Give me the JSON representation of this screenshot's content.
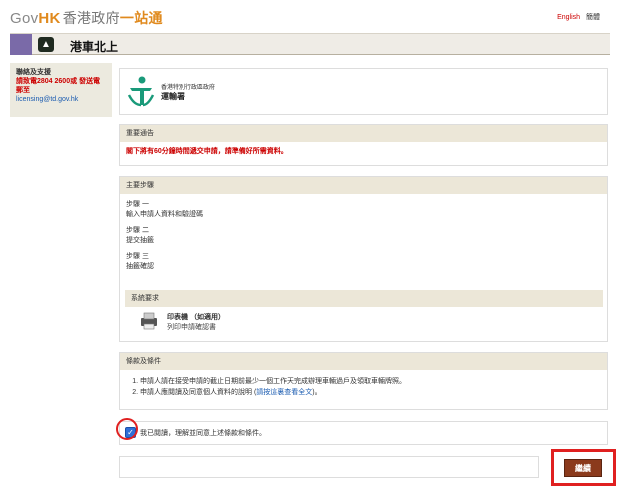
{
  "header": {
    "logo_gov": "Gov",
    "logo_hk": "HK",
    "logo_zh": "香港政府",
    "logo_one": "一站通",
    "lang_en": "English",
    "lang_sc": "簡體"
  },
  "titlebar": {
    "title": "港車北上"
  },
  "sidebar": {
    "title": "聯絡及支援",
    "phone": "請致電2804 2600或 發送電郵至",
    "email": "licensing@td.gov.hk"
  },
  "agency": {
    "gov_name": "香港特別行政區政府",
    "dept_name": "運輸署"
  },
  "notice": {
    "header": "重要通告",
    "text": "閣下將有60分鐘時間遞交申請，請準備好所需資料。"
  },
  "steps": {
    "header": "主要步驟",
    "items": [
      {
        "title": "步驟 一",
        "desc": "輸入申請人資料和驗證碼"
      },
      {
        "title": "步驟 二",
        "desc": "提交抽籤"
      },
      {
        "title": "步驟 三",
        "desc": "抽籤確認"
      }
    ],
    "sysreq_header": "系統要求",
    "printer_title": "印表機 （如適用）",
    "printer_desc": "列印申請確認書",
    "printer_icon": "printer-icon"
  },
  "terms": {
    "header": "條款及條件",
    "item1": "申請人請在接受申請的截止日期前最少一個工作天完成辦理車輛過戶及領取車輛牌照。",
    "item2_prefix": "申請人應閱讀及同意個人資料的說明 (",
    "item2_link": "請按這裏查看全文",
    "item2_suffix": ")。"
  },
  "agree": {
    "checked": true,
    "text": "我已閱讀，理解並同意上述條款和條件。"
  },
  "footer": {
    "continue_label": "繼續"
  },
  "colors": {
    "accent": "#e08a1e",
    "alert": "#cc0000",
    "button": "#8b3a1c",
    "highlight": "#e02020"
  }
}
